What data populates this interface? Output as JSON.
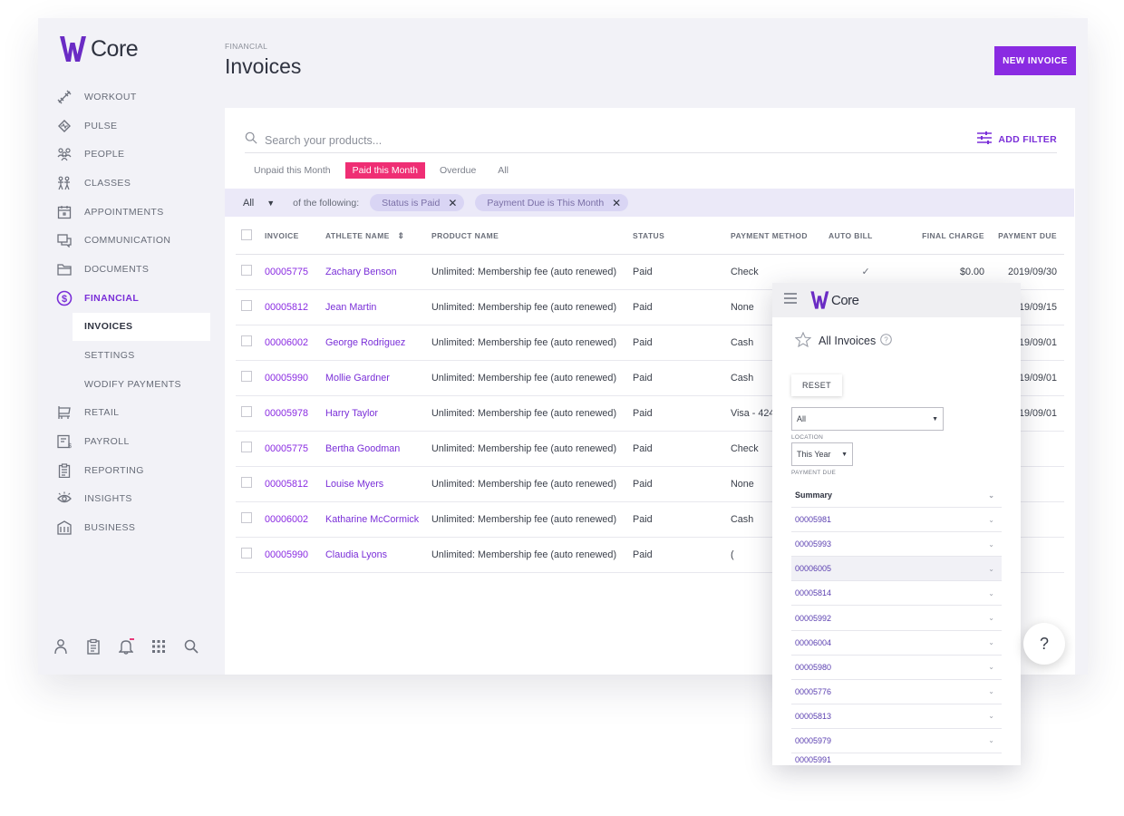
{
  "app": {
    "logo_text": "Core"
  },
  "sidebar": {
    "items": [
      {
        "key": "workout",
        "label": "WORKOUT",
        "icon": "dumbbell-icon"
      },
      {
        "key": "pulse",
        "label": "PULSE",
        "icon": "pulse-icon"
      },
      {
        "key": "people",
        "label": "PEOPLE",
        "icon": "people-icon"
      },
      {
        "key": "classes",
        "label": "CLASSES",
        "icon": "classes-icon"
      },
      {
        "key": "appointments",
        "label": "APPOINTMENTS",
        "icon": "calendar-icon"
      },
      {
        "key": "communication",
        "label": "COMMUNICATION",
        "icon": "chat-icon"
      },
      {
        "key": "documents",
        "label": "DOCUMENTS",
        "icon": "folder-icon"
      },
      {
        "key": "financial",
        "label": "FINANCIAL",
        "icon": "dollar-icon",
        "active": true
      }
    ],
    "financial_sub": [
      {
        "label": "INVOICES",
        "selected": true
      },
      {
        "label": "SETTINGS"
      },
      {
        "label": "WODIFY PAYMENTS"
      }
    ],
    "items_after": [
      {
        "key": "retail",
        "label": "RETAIL",
        "icon": "retail-icon"
      },
      {
        "key": "payroll",
        "label": "PAYROLL",
        "icon": "payroll-icon"
      },
      {
        "key": "reporting",
        "label": "REPORTING",
        "icon": "clipboard-icon"
      },
      {
        "key": "insights",
        "label": "INSIGHTS",
        "icon": "eye-icon"
      },
      {
        "key": "business",
        "label": "BUSINESS",
        "icon": "building-icon"
      }
    ],
    "bottom_icons": [
      "user-icon",
      "clipboard-icon",
      "bell-icon",
      "apps-grid-icon",
      "search-icon"
    ]
  },
  "header": {
    "breadcrumb": "FINANCIAL",
    "title": "Invoices",
    "new_invoice_label": "NEW INVOICE"
  },
  "search": {
    "placeholder": "Search your products...",
    "add_filter_label": "ADD FILTER"
  },
  "tabs": [
    {
      "label": "Unpaid this Month",
      "active": false
    },
    {
      "label": "Paid this Month",
      "active": true
    },
    {
      "label": "Overdue",
      "active": false
    },
    {
      "label": "All",
      "active": false
    }
  ],
  "filter_bar": {
    "scope": "All",
    "text": "of the following:",
    "chips": [
      "Status is Paid",
      "Payment Due is This Month"
    ]
  },
  "table": {
    "columns": [
      "INVOICE",
      "ATHLETE NAME",
      "PRODUCT NAME",
      "STATUS",
      "PAYMENT METHOD",
      "AUTO BILL",
      "FINAL CHARGE",
      "PAYMENT DUE"
    ],
    "rows": [
      {
        "invoice": "00005775",
        "athlete": "Zachary Benson",
        "product": "Unlimited: Membership fee (auto renewed)",
        "status": "Paid",
        "method": "Check",
        "auto_bill": "✓",
        "charge": "$0.00",
        "due": "2019/09/30"
      },
      {
        "invoice": "00005812",
        "athlete": "Jean Martin",
        "product": "Unlimited: Membership fee (auto renewed)",
        "status": "Paid",
        "method": "None",
        "auto_bill": "",
        "charge": "",
        "due": "19/09/15"
      },
      {
        "invoice": "00006002",
        "athlete": "George Rodriguez",
        "product": "Unlimited: Membership fee (auto renewed)",
        "status": "Paid",
        "method": "Cash",
        "auto_bill": "",
        "charge": "",
        "due": "19/09/01"
      },
      {
        "invoice": "00005990",
        "athlete": "Mollie Gardner",
        "product": "Unlimited: Membership fee (auto renewed)",
        "status": "Paid",
        "method": "Cash",
        "auto_bill": "",
        "charge": "",
        "due": "19/09/01"
      },
      {
        "invoice": "00005978",
        "athlete": "Harry Taylor",
        "product": "Unlimited: Membership fee (auto renewed)",
        "status": "Paid",
        "method": "Visa - 424",
        "auto_bill": "",
        "charge": "",
        "due": "19/09/01"
      },
      {
        "invoice": "00005775",
        "athlete": "Bertha Goodman",
        "product": "Unlimited: Membership fee (auto renewed)",
        "status": "Paid",
        "method": "Check",
        "auto_bill": "",
        "charge": "",
        "due": ""
      },
      {
        "invoice": "00005812",
        "athlete": "Louise Myers",
        "product": "Unlimited: Membership fee (auto renewed)",
        "status": "Paid",
        "method": "None",
        "auto_bill": "",
        "charge": "",
        "due": ""
      },
      {
        "invoice": "00006002",
        "athlete": "Katharine McCormick",
        "product": "Unlimited: Membership fee (auto renewed)",
        "status": "Paid",
        "method": "Cash",
        "auto_bill": "",
        "charge": "",
        "due": ""
      },
      {
        "invoice": "00005990",
        "athlete": "Claudia Lyons",
        "product": "Unlimited: Membership fee (auto renewed)",
        "status": "Paid",
        "method": "(",
        "auto_bill": "",
        "charge": "",
        "due": ""
      }
    ]
  },
  "mobile": {
    "logo_text": "Core",
    "title": "All Invoices",
    "reset_label": "RESET",
    "select_all": "All",
    "location_label": "LOCATION",
    "period": "This Year",
    "payment_due_label": "PAYMENT DUE",
    "summary_label": "Summary",
    "invoices": [
      "00005981",
      "00005993",
      "00006005",
      "00005814",
      "00005992",
      "00006004",
      "00005980",
      "00005776",
      "00005813",
      "00005979",
      "00005991"
    ]
  },
  "help_label": "?",
  "colors": {
    "brand_purple": "#8a2be2",
    "active_tab_pink": "#ef2e74",
    "filter_bar": "#ebe9f8",
    "chip": "#d9d5f4"
  }
}
